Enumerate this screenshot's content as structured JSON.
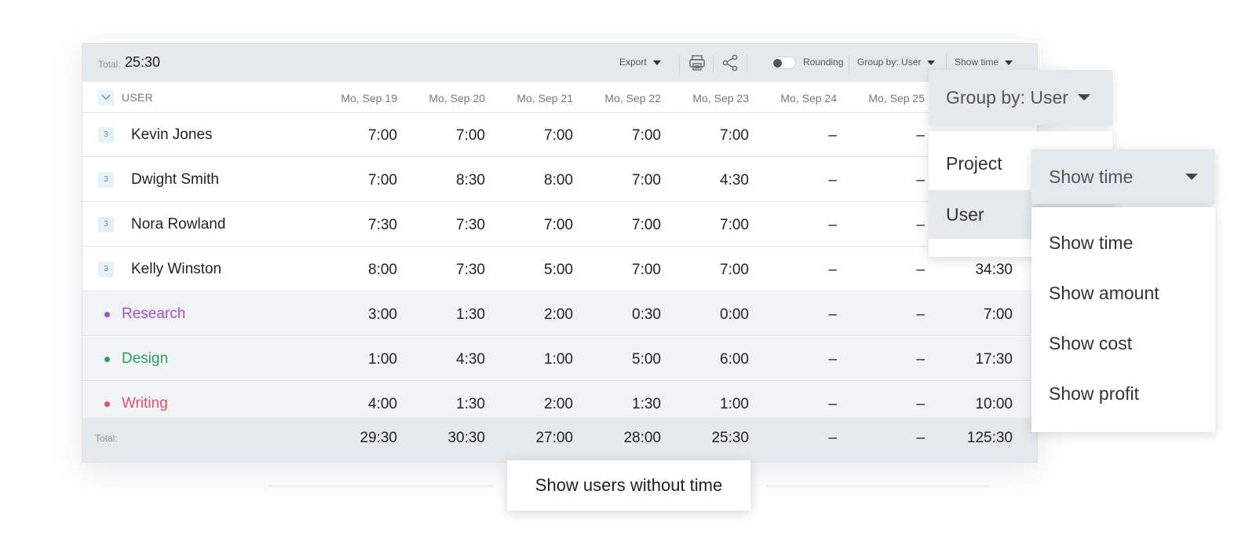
{
  "toolbar": {
    "total_label": "Total:",
    "total_value": "25:30",
    "export_label": "Export",
    "print_icon": "printer-icon",
    "share_icon": "share-icon",
    "rounding_label": "Rounding",
    "rounding_enabled": false,
    "group_by_label": "Group by: User",
    "show_time_label": "Show time"
  },
  "table": {
    "user_header": "USER",
    "columns": [
      "Mo, Sep 19",
      "Mo, Sep 20",
      "Mo, Sep 21",
      "Mo, Sep 22",
      "Mo, Sep 23",
      "Mo, Sep 24",
      "Mo, Sep 25"
    ],
    "users": [
      {
        "badge": "3",
        "name": "Kevin Jones",
        "values": [
          "7:00",
          "7:00",
          "7:00",
          "7:00",
          "7:00",
          "–",
          "–"
        ],
        "total": ""
      },
      {
        "badge": "3",
        "name": "Dwight Smith",
        "values": [
          "7:00",
          "8:30",
          "8:00",
          "7:00",
          "4:30",
          "–",
          "–"
        ],
        "total": ""
      },
      {
        "badge": "3",
        "name": "Nora Rowland",
        "values": [
          "7:30",
          "7:30",
          "7:00",
          "7:00",
          "7:00",
          "–",
          "–"
        ],
        "total": ""
      },
      {
        "badge": "3",
        "name": "Kelly Winston",
        "values": [
          "8:00",
          "7:30",
          "5:00",
          "7:00",
          "7:00",
          "–",
          "–"
        ],
        "total": "34:30"
      }
    ],
    "projects": [
      {
        "name": "Research",
        "color": "#a24fc9",
        "values": [
          "3:00",
          "1:30",
          "2:00",
          "0:30",
          "0:00",
          "–",
          "–"
        ],
        "total": "7:00"
      },
      {
        "name": "Design",
        "color": "#2e9e5c",
        "values": [
          "1:00",
          "4:30",
          "1:00",
          "5:00",
          "6:00",
          "–",
          "–"
        ],
        "total": "17:30"
      },
      {
        "name": "Writing",
        "color": "#e0506a",
        "values": [
          "4:00",
          "1:30",
          "2:00",
          "1:30",
          "1:00",
          "–",
          "–"
        ],
        "total": "10:00"
      }
    ],
    "totals": {
      "label": "Total:",
      "values": [
        "29:30",
        "30:30",
        "27:00",
        "28:00",
        "25:30",
        "–",
        "–"
      ],
      "total": "125:30"
    }
  },
  "show_users_button": "Show users without time",
  "group_by_dropdown": {
    "label": "Group by: User",
    "options": [
      "Project",
      "User"
    ],
    "selected": "User"
  },
  "show_time_dropdown": {
    "label": "Show time",
    "options": [
      "Show time",
      "Show amount",
      "Show cost",
      "Show profit"
    ]
  }
}
